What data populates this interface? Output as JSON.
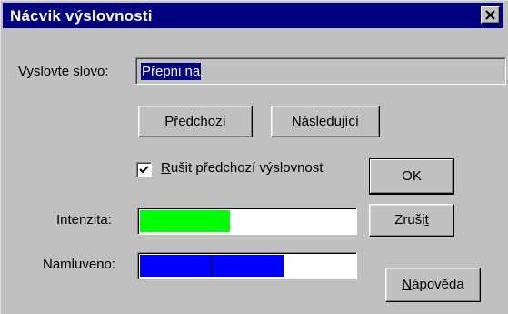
{
  "window": {
    "title": "Nácvik výslovnosti"
  },
  "word_field": {
    "label": "Vyslovte slovo:",
    "value": "Přepni na"
  },
  "nav": {
    "previous": {
      "pre": "",
      "ul": "P",
      "post": "ředchozí"
    },
    "next": {
      "pre": "",
      "ul": "N",
      "post": "ásledující"
    }
  },
  "discard_checkbox": {
    "checked": true,
    "label": {
      "pre": "",
      "ul": "R",
      "post": "ušit předchozí výslovnost"
    }
  },
  "buttons": {
    "ok": "OK",
    "cancel": {
      "pre": "Zruši",
      "ul": "t",
      "post": ""
    },
    "help": {
      "pre": "",
      "ul": "N",
      "post": "ápověda"
    }
  },
  "intensity": {
    "label": "Intenzita:",
    "level": 0.42,
    "color": "#00ff00"
  },
  "recorded": {
    "label": "Namluveno:",
    "level": 0.67,
    "segments_shown": 2,
    "color": "#0000ff"
  }
}
